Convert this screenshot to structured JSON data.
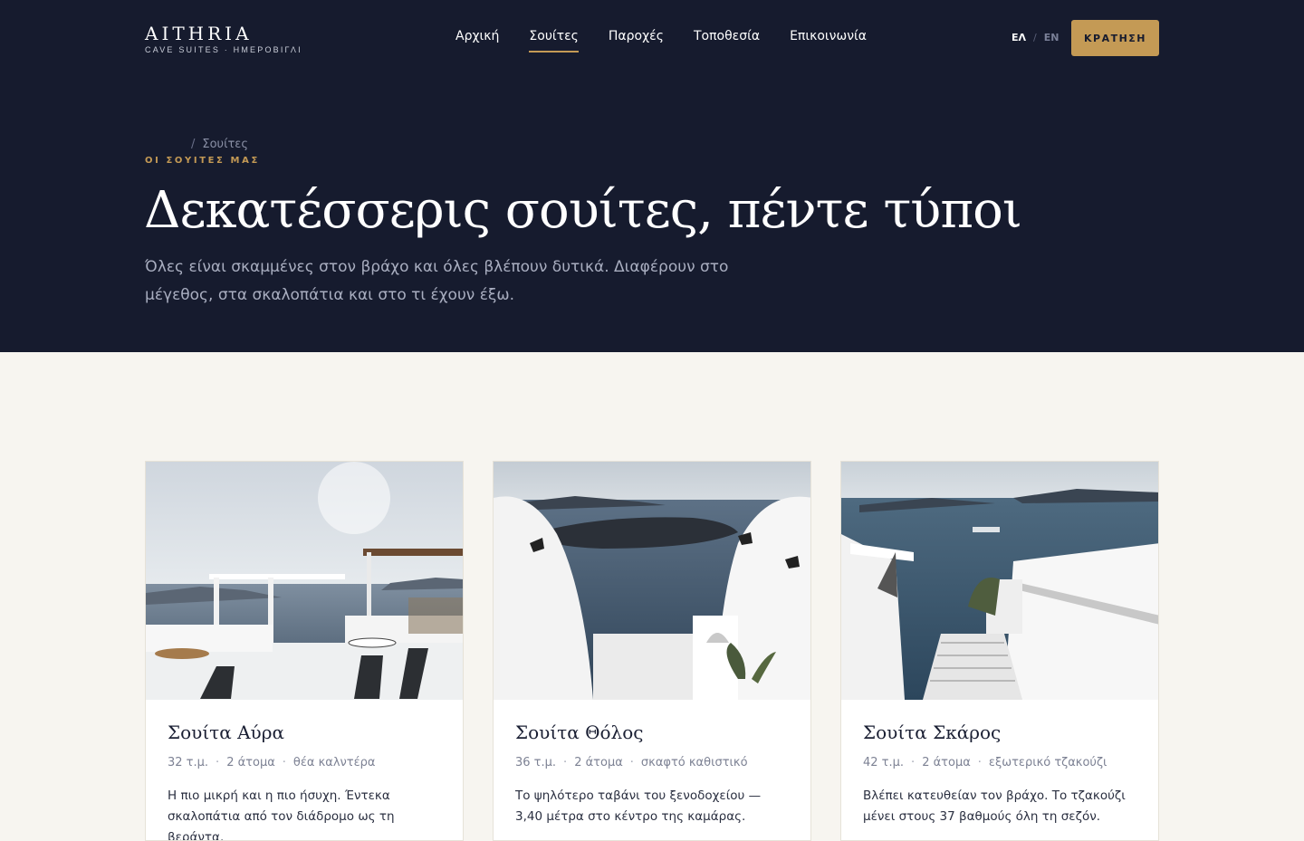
{
  "brand": {
    "name": "AITHRIA",
    "tagline": "CAVE SUITES · ΗΜΕΡΟΒΙΓΛΙ"
  },
  "nav": {
    "items": [
      {
        "label": "Αρχική",
        "active": false
      },
      {
        "label": "Σουίτες",
        "active": true
      },
      {
        "label": "Παροχές",
        "active": false
      },
      {
        "label": "Τοποθεσία",
        "active": false
      },
      {
        "label": "Επικοινωνία",
        "active": false
      }
    ],
    "lang": {
      "current": "ΕΛ",
      "separator": "/",
      "other": "EN"
    },
    "book_label": "ΚΡΑΤΗΣΗ"
  },
  "hero": {
    "breadcrumb": {
      "separator": "/",
      "current": "Σουίτες"
    },
    "eyebrow": "ΟΙ ΣΟΥΙΤΕΣ ΜΑΣ",
    "title": "Δεκατέσσερις σουίτες, πέντε τύποι",
    "lead": "Όλες είναι σκαμμένες στον βράχο και όλες βλέπουν δυτικά. Διαφέρουν στο μέγεθος, στα σκαλοπάτια και στο τι έχουν έξω."
  },
  "suites": [
    {
      "title": "Σουίτα Αύρα",
      "meta": [
        "32 τ.μ.",
        "2 άτομα",
        "θέα καλντέρα"
      ],
      "desc": "Η πιο μικρή και η πιο ήσυχη. Έντεκα σκαλοπάτια από τον διάδρομο ως τη βεράντα."
    },
    {
      "title": "Σουίτα Θόλος",
      "meta": [
        "36 τ.μ.",
        "2 άτομα",
        "σκαφτό καθιστικό"
      ],
      "desc": "Το ψηλότερο ταβάνι του ξενοδοχείου — 3,40 μέτρα στο κέντρο της καμάρας."
    },
    {
      "title": "Σουίτα Σκάρος",
      "meta": [
        "42 τ.μ.",
        "2 άτομα",
        "εξωτερικό τζακούζι"
      ],
      "desc": "Βλέπει κατευθείαν τον βράχο. Το τζακούζι μένει στους 37 βαθμούς όλη τη σεζόν."
    }
  ],
  "meta_separator": "·",
  "colors": {
    "navy": "#161b2e",
    "gold": "#c49a55",
    "cream": "#f7f5f0"
  }
}
